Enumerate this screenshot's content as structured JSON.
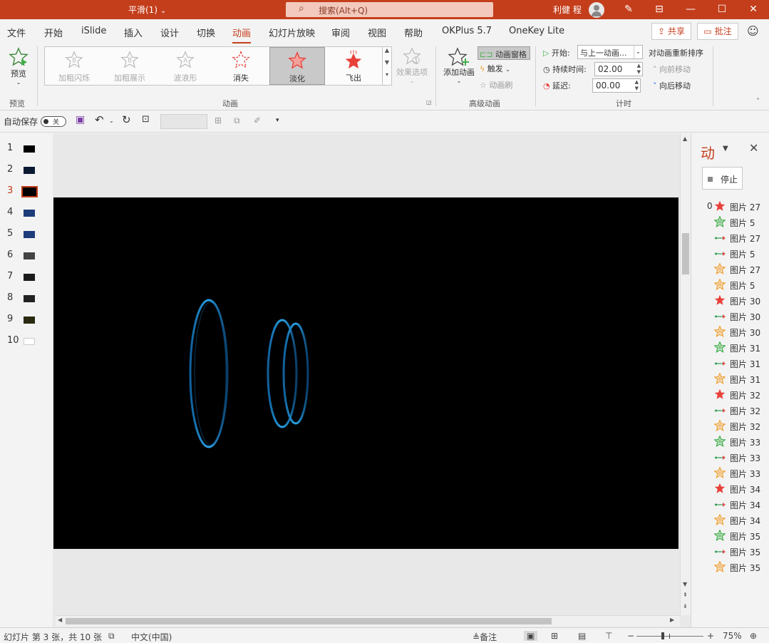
{
  "titlebar": {
    "doc_name": "平滑(1)",
    "doc_dropdown": "⌄",
    "search_placeholder": "搜索(Alt+Q)",
    "user_name": "利健 程",
    "minimize": "—",
    "restore": "☐",
    "close": "✕",
    "accent": "#c43e1c"
  },
  "menu": {
    "tabs": [
      "文件",
      "开始",
      "iSlide",
      "插入",
      "设计",
      "切换",
      "动画",
      "幻灯片放映",
      "审阅",
      "视图",
      "帮助",
      "OKPlus 5.7",
      "OneKey Lite"
    ],
    "active_tab": "动画",
    "share_label": "共享",
    "comment_label": "批注"
  },
  "ribbon": {
    "preview": {
      "button_label": "预览",
      "group_label": "预览"
    },
    "animation_gallery": {
      "group_label": "动画",
      "items": [
        {
          "label": "加粗闪烁",
          "enabled": false
        },
        {
          "label": "加粗展示",
          "enabled": false
        },
        {
          "label": "波浪形",
          "enabled": false
        },
        {
          "label": "消失",
          "enabled": true
        },
        {
          "label": "淡化",
          "enabled": true,
          "selected": true
        },
        {
          "label": "飞出",
          "enabled": true
        }
      ],
      "effect_options_label": "效果选项"
    },
    "advanced": {
      "group_label": "高级动画",
      "add_animation_label": "添加动画",
      "animation_pane_label": "动画窗格",
      "trigger_label": "触发",
      "painter_label": "动画刷"
    },
    "timing": {
      "group_label": "计时",
      "start_label": "开始:",
      "start_value": "与上一动画...",
      "duration_label": "持续时间:",
      "duration_value": "02.00",
      "delay_label": "延迟:",
      "delay_value": "00.00",
      "reorder_label": "对动画重新排序",
      "move_earlier_label": "向前移动",
      "move_later_label": "向后移动"
    }
  },
  "qat": {
    "autosave_label": "自动保存",
    "autosave_state": "关"
  },
  "slides": {
    "numbers": [
      "1",
      "2",
      "3",
      "4",
      "5",
      "6",
      "7",
      "8",
      "9",
      "10"
    ],
    "current": "3"
  },
  "animation_pane": {
    "title": "动",
    "stop_label": "停止",
    "first_index": "0",
    "items": [
      {
        "type": "emphasis-red",
        "label": "图片 27"
      },
      {
        "type": "entrance-green",
        "label": "图片 5"
      },
      {
        "type": "motion-path",
        "label": "图片 27"
      },
      {
        "type": "motion-path",
        "label": "图片 5"
      },
      {
        "type": "exit-orange",
        "label": "图片 27"
      },
      {
        "type": "exit-orange",
        "label": "图片 5"
      },
      {
        "type": "emphasis-red",
        "label": "图片 30"
      },
      {
        "type": "motion-path",
        "label": "图片 30"
      },
      {
        "type": "exit-orange",
        "label": "图片 30"
      },
      {
        "type": "entrance-green",
        "label": "图片 31"
      },
      {
        "type": "motion-path",
        "label": "图片 31"
      },
      {
        "type": "exit-orange",
        "label": "图片 31"
      },
      {
        "type": "emphasis-red",
        "label": "图片 32"
      },
      {
        "type": "motion-path",
        "label": "图片 32"
      },
      {
        "type": "exit-orange",
        "label": "图片 32"
      },
      {
        "type": "entrance-green",
        "label": "图片 33"
      },
      {
        "type": "motion-path",
        "label": "图片 33"
      },
      {
        "type": "exit-orange",
        "label": "图片 33"
      },
      {
        "type": "emphasis-red",
        "label": "图片 34"
      },
      {
        "type": "motion-path",
        "label": "图片 34"
      },
      {
        "type": "exit-orange",
        "label": "图片 34"
      },
      {
        "type": "entrance-green",
        "label": "图片 35"
      },
      {
        "type": "motion-path",
        "label": "图片 35"
      },
      {
        "type": "exit-orange",
        "label": "图片 35"
      }
    ]
  },
  "statusbar": {
    "slide_info": "幻灯片 第 3 张，共 10 张",
    "language": "中文(中国)",
    "notes_label": "备注",
    "zoom_minus": "−",
    "zoom_plus": "+",
    "zoom_level": "75%"
  },
  "colors": {
    "star_red": "#e8413a",
    "star_green": "#3fae49",
    "star_orange": "#f0a030",
    "path_green": "#2f9a55",
    "path_red": "#d9534f",
    "ring_blue": "#1e8fd6"
  }
}
